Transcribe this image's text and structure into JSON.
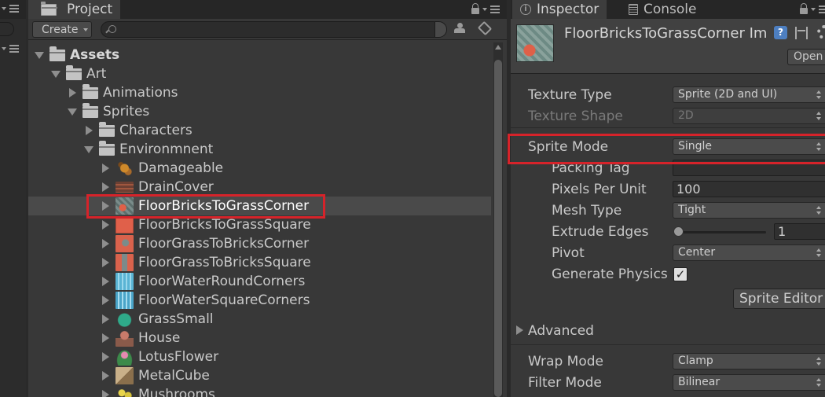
{
  "project": {
    "tab_label": "Project",
    "create_label": "Create",
    "search_placeholder": "",
    "tree": [
      {
        "label": "Assets",
        "arrow": "down",
        "kind": "folder",
        "indent": 0,
        "root": true
      },
      {
        "label": "Art",
        "arrow": "down",
        "kind": "folder",
        "indent": 1
      },
      {
        "label": "Animations",
        "arrow": "right",
        "kind": "folder",
        "indent": 2
      },
      {
        "label": "Sprites",
        "arrow": "down",
        "kind": "folder",
        "indent": 2
      },
      {
        "label": "Characters",
        "arrow": "right",
        "kind": "folder",
        "indent": 3
      },
      {
        "label": "Environmnent",
        "arrow": "down",
        "kind": "folder",
        "indent": 3
      },
      {
        "label": "Damageable",
        "arrow": "right",
        "kind": "asset",
        "indent": 4,
        "icon": "damageable-icon"
      },
      {
        "label": "DrainCover",
        "arrow": "right",
        "kind": "asset",
        "indent": 4,
        "icon": "drain-cover-icon"
      },
      {
        "label": "FloorBricksToGrassCorner",
        "arrow": "right",
        "kind": "asset",
        "indent": 4,
        "icon": "floor-bricks-corner-icon",
        "selected": true
      },
      {
        "label": "FloorBricksToGrassSquare",
        "arrow": "right",
        "kind": "asset",
        "indent": 4,
        "icon": "floor-bricks-square-icon"
      },
      {
        "label": "FloorGrassToBricksCorner",
        "arrow": "right",
        "kind": "asset",
        "indent": 4,
        "icon": "floor-grass-corner-icon"
      },
      {
        "label": "FloorGrassToBricksSquare",
        "arrow": "right",
        "kind": "asset",
        "indent": 4,
        "icon": "floor-grass-square-icon"
      },
      {
        "label": "FloorWaterRoundCorners",
        "arrow": "right",
        "kind": "asset",
        "indent": 4,
        "icon": "water-round-icon"
      },
      {
        "label": "FloorWaterSquareCorners",
        "arrow": "right",
        "kind": "asset",
        "indent": 4,
        "icon": "water-square-icon"
      },
      {
        "label": "GrassSmall",
        "arrow": "right",
        "kind": "asset",
        "indent": 4,
        "icon": "grass-small-icon"
      },
      {
        "label": "House",
        "arrow": "right",
        "kind": "asset",
        "indent": 4,
        "icon": "house-icon"
      },
      {
        "label": "LotusFlower",
        "arrow": "right",
        "kind": "asset",
        "indent": 4,
        "icon": "lotus-flower-icon"
      },
      {
        "label": "MetalCube",
        "arrow": "right",
        "kind": "asset",
        "indent": 4,
        "icon": "metal-cube-icon"
      },
      {
        "label": "Mushrooms",
        "arrow": "right",
        "kind": "asset",
        "indent": 4,
        "icon": "mushrooms-icon"
      }
    ]
  },
  "inspector": {
    "tab_label": "Inspector",
    "console_tab_label": "Console",
    "title": "FloorBricksToGrassCorner Im",
    "help_glyph": "?",
    "open_label": "Open",
    "texture_type": {
      "label": "Texture Type",
      "value": "Sprite (2D and UI)"
    },
    "texture_shape": {
      "label": "Texture Shape",
      "value": "2D"
    },
    "sprite_mode": {
      "label": "Sprite Mode",
      "value": "Single"
    },
    "packing_tag": {
      "label": "Packing Tag",
      "value": ""
    },
    "pixels_per_unit": {
      "label": "Pixels Per Unit",
      "value": "100"
    },
    "mesh_type": {
      "label": "Mesh Type",
      "value": "Tight"
    },
    "extrude_edges": {
      "label": "Extrude Edges",
      "value": "1"
    },
    "pivot": {
      "label": "Pivot",
      "value": "Center"
    },
    "generate_physics": {
      "label": "Generate Physics",
      "checkmark": "✓"
    },
    "sprite_editor_label": "Sprite Editor",
    "advanced_label": "Advanced",
    "wrap_mode": {
      "label": "Wrap Mode",
      "value": "Clamp"
    },
    "filter_mode": {
      "label": "Filter Mode",
      "value": "Bilinear"
    }
  },
  "colors": {
    "highlight": "#d6232a",
    "selection": "#4a4a4a",
    "panel_bg": "#383838"
  }
}
